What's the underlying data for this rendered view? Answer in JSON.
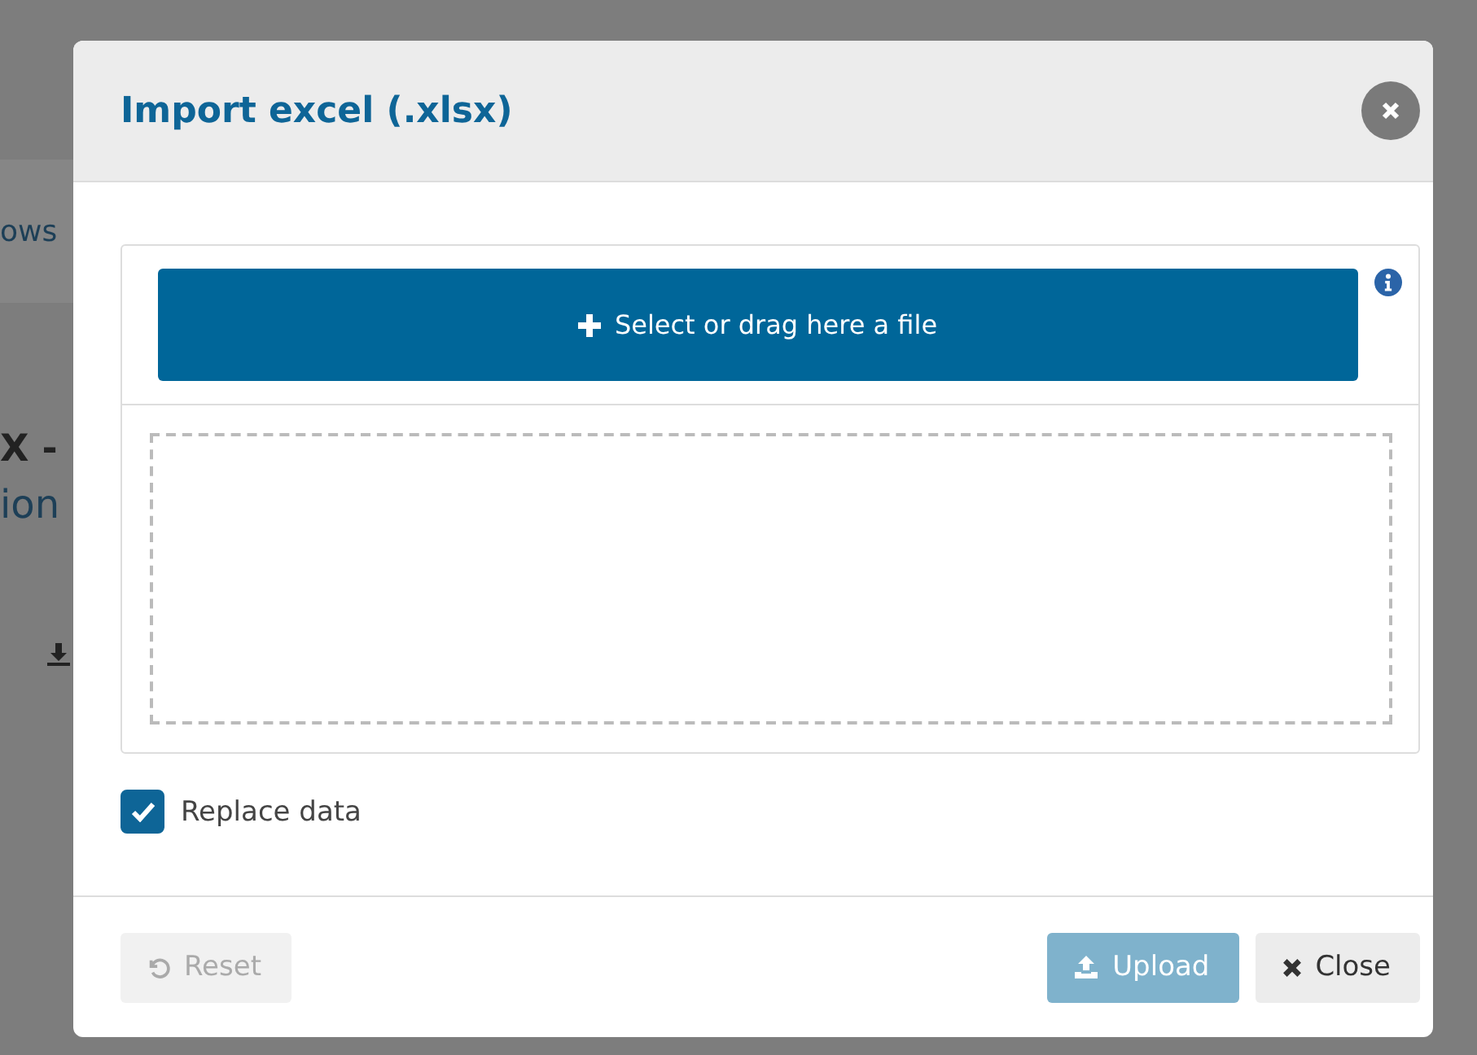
{
  "background": {
    "breadcrumb": "ows",
    "heading": "X -",
    "subheading": "ion"
  },
  "dialog": {
    "title": "Import excel (.xlsx)",
    "select_button": "Select or drag here a file",
    "replace_data": {
      "label": "Replace data",
      "checked": true
    },
    "buttons": [
      {
        "label": "Reset",
        "kind": "reset",
        "disabled": true
      },
      {
        "label": "Upload",
        "kind": "upload",
        "disabled": true
      },
      {
        "label": "Close",
        "kind": "close",
        "disabled": false
      }
    ]
  }
}
